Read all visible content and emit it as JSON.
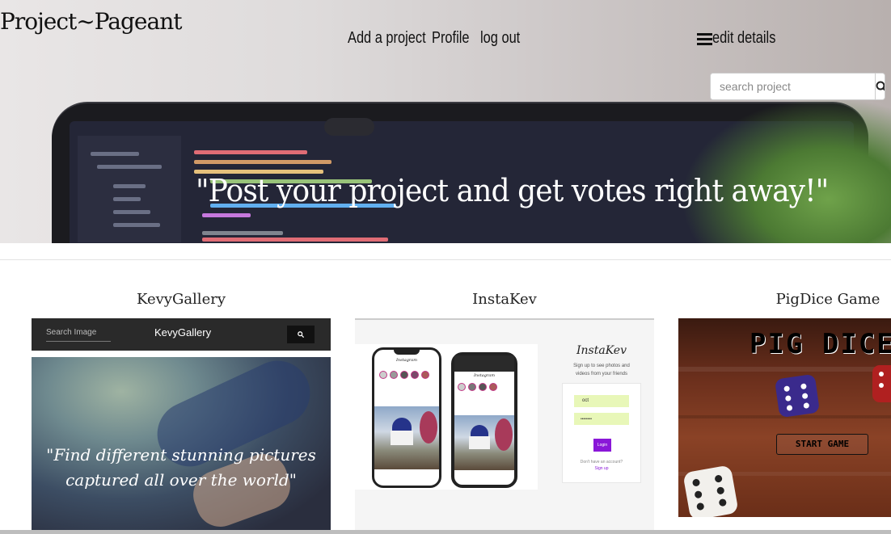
{
  "header": {
    "brand": "Project~Pageant",
    "nav": {
      "add_project": "Add a project",
      "profile": "Profile",
      "logout": "log out",
      "edit_details": "edit details"
    },
    "search": {
      "placeholder": "search project"
    }
  },
  "hero": {
    "tagline": "\"Post your project and get votes right away!\""
  },
  "projects": [
    {
      "title": "KevyGallery",
      "preview": {
        "search_placeholder": "Search Image",
        "app_title": "KevyGallery",
        "quote_line1": "\"Find different stunning pictures",
        "quote_line2": "captured all over the world\""
      }
    },
    {
      "title": "InstaKev",
      "preview": {
        "brand": "InstaKev",
        "subtitle_line1": "Sign up to see photos and",
        "subtitle_line2": "videos from your friends",
        "field1_value": "oct",
        "field2_value": "••••••••",
        "login_label": "Login",
        "no_account": "Don't have an account?",
        "signup_link": "Sign up",
        "phone_app_name": "Instagram"
      }
    },
    {
      "title": "PigDice Game",
      "preview": {
        "game_title": "PIG DICE",
        "start_label": "START GAME"
      }
    }
  ],
  "colors": {
    "nav_text": "#111111",
    "instakev_button": "#8a17d8",
    "pig_title": "#000000"
  }
}
